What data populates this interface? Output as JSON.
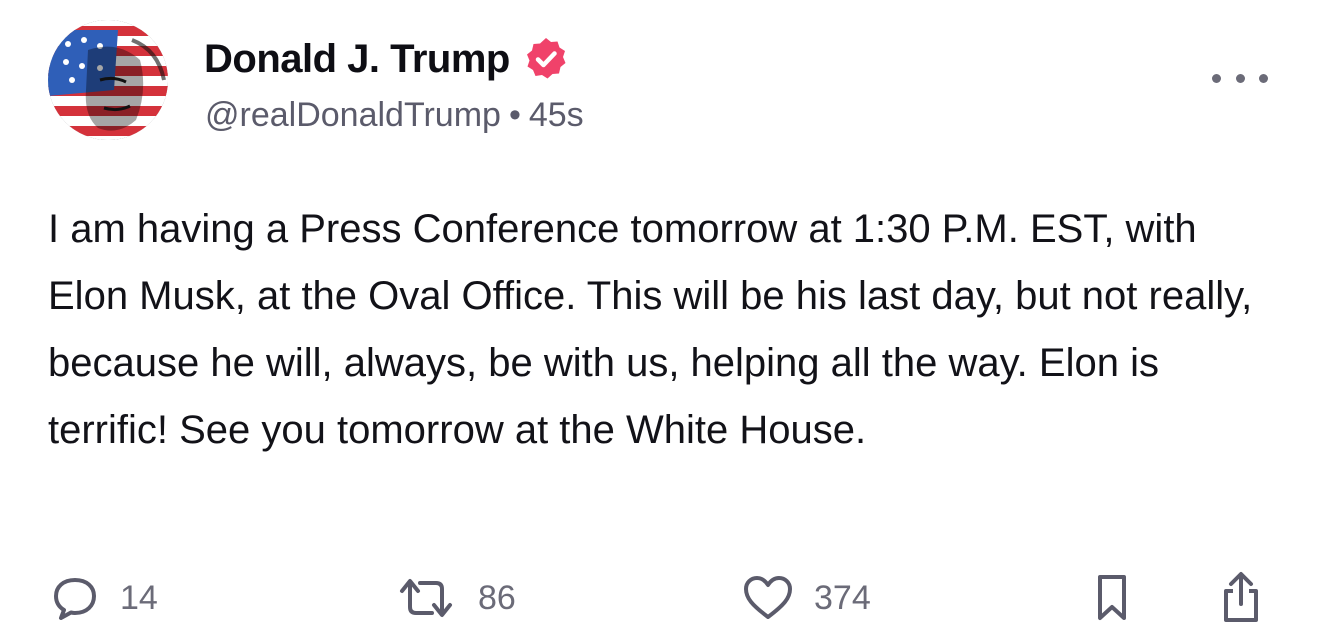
{
  "post": {
    "author": {
      "display_name": "Donald J. Trump",
      "handle": "@realDonaldTrump",
      "verified_icon": "verified-badge-icon",
      "avatar": "flag-portrait-avatar"
    },
    "separator": "•",
    "time": "45s",
    "text": "I am having a Press Conference tomorrow at 1:30 P.M. EST, with Elon Musk, at the Oval Office. This will be his last day, but not really, because he will, always, be with us, helping all the way. Elon is terrific! See you tomorrow at the White House.",
    "actions": {
      "reply_count": "14",
      "repost_count": "86",
      "like_count": "374"
    }
  },
  "colors": {
    "verified": "#f0426a",
    "text": "#121218",
    "muted": "#6b6b78"
  }
}
